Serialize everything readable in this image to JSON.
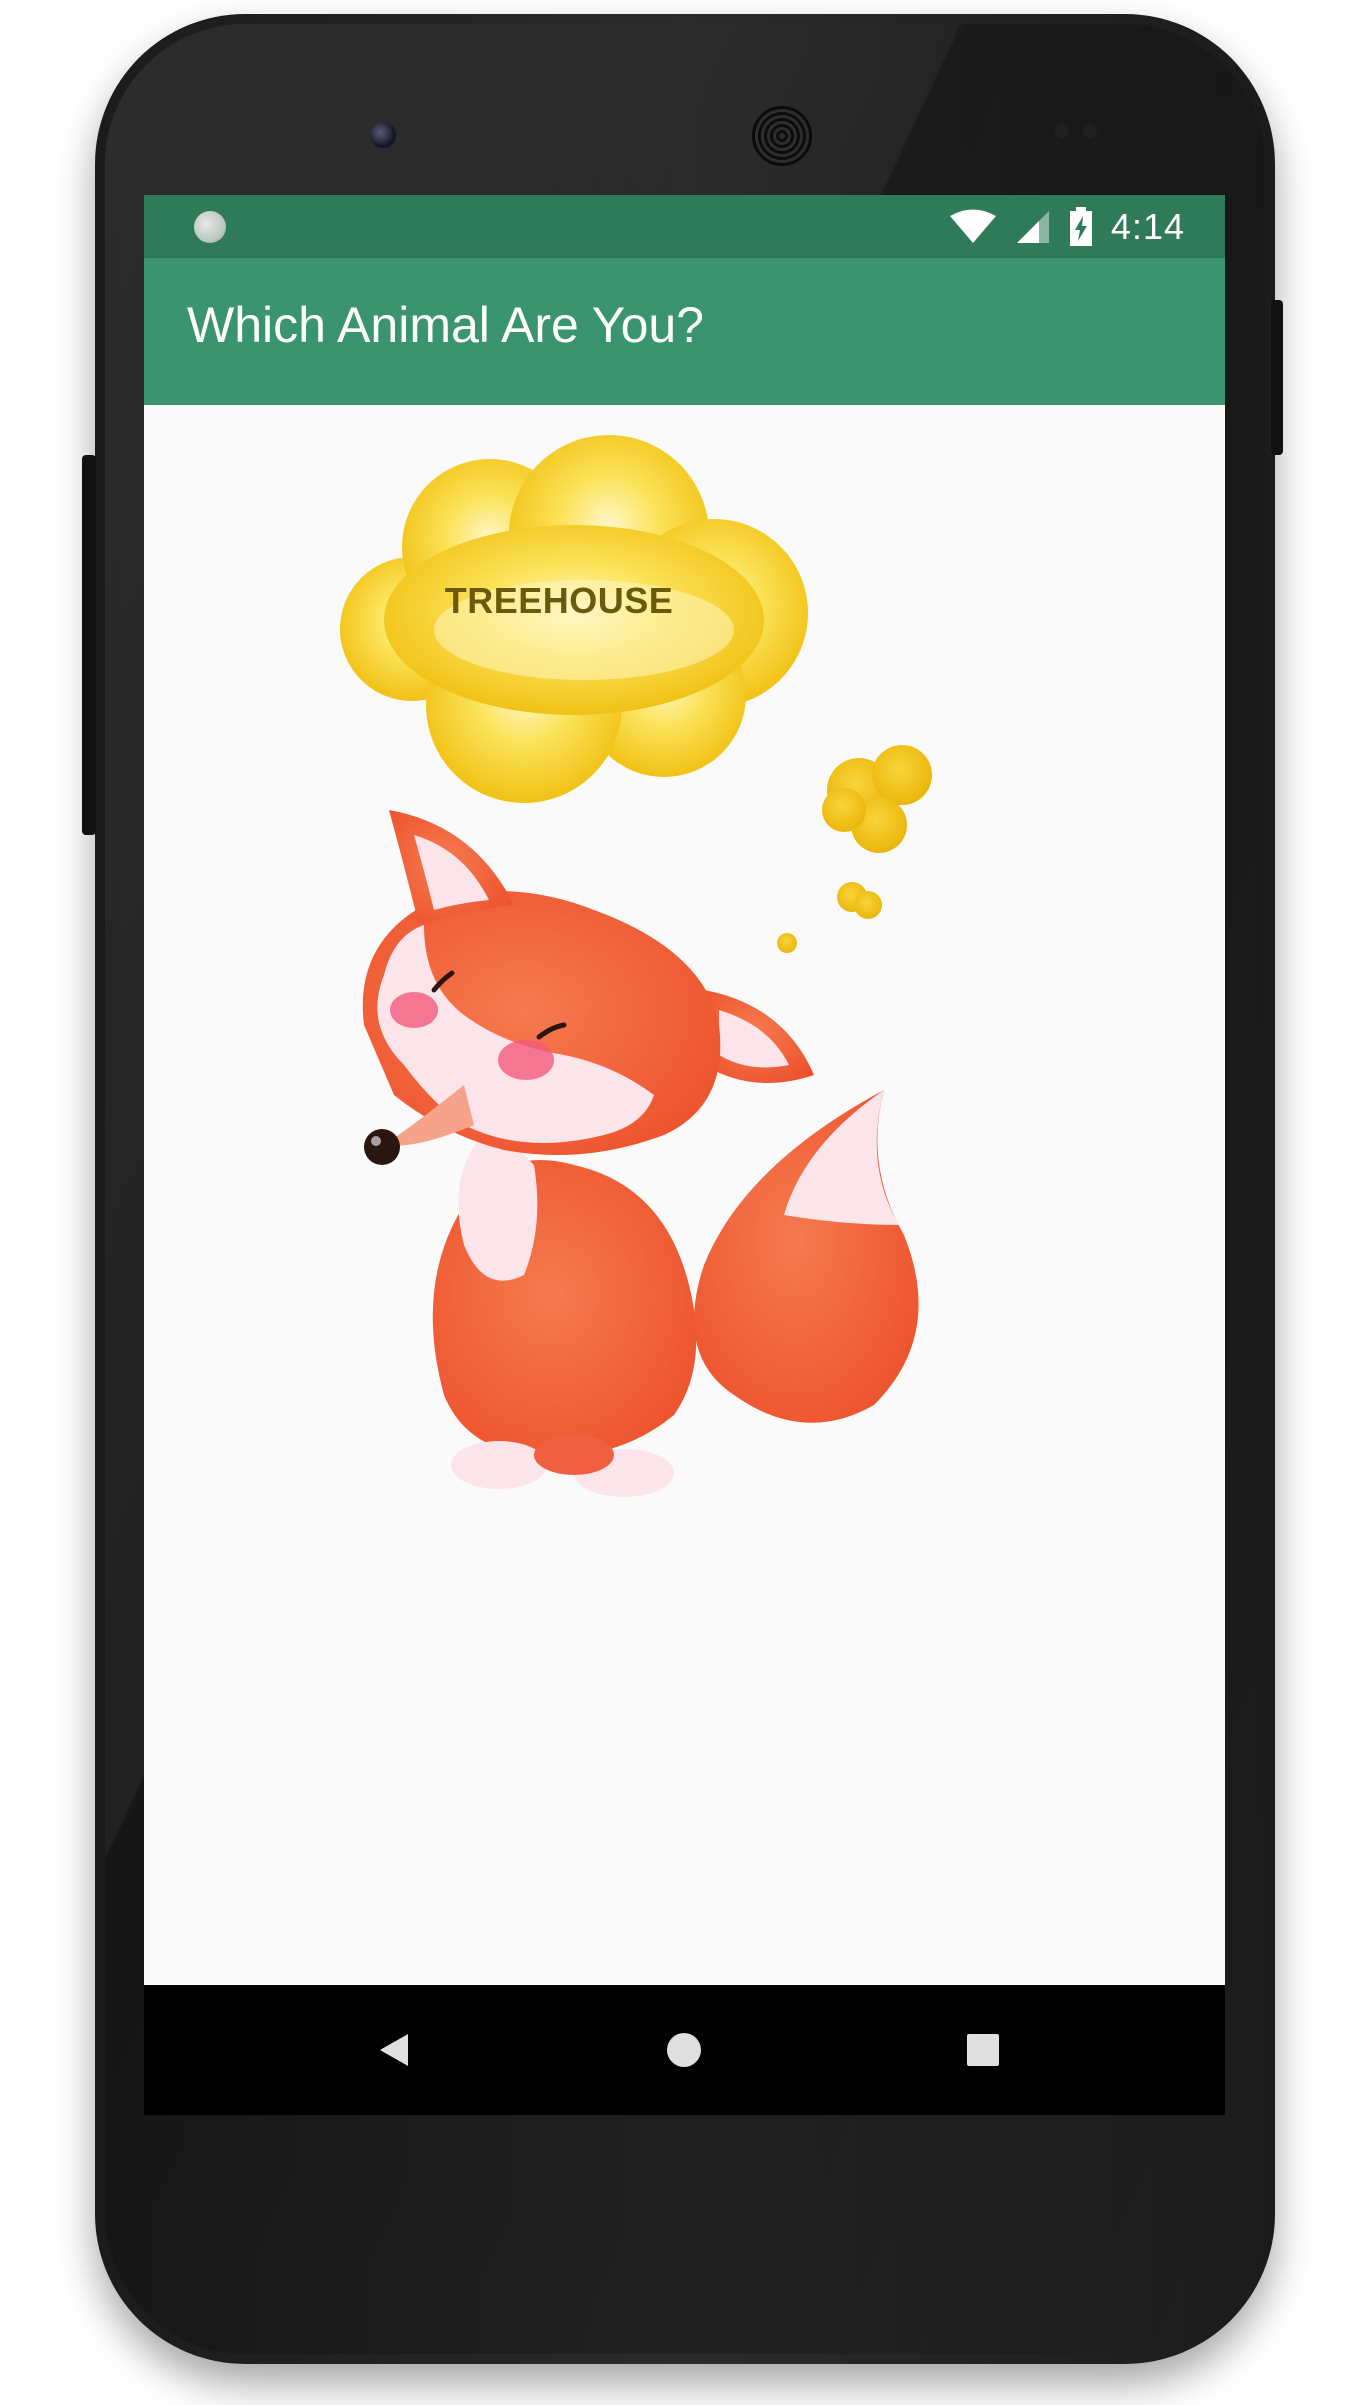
{
  "status_bar": {
    "time": "4:14",
    "icons": [
      "sync-icon",
      "wifi-icon",
      "cellular-signal-icon",
      "battery-charging-icon"
    ]
  },
  "app_bar": {
    "title": "Which Animal Are You?"
  },
  "main": {
    "thought_bubble_text": "TREEHOUSE",
    "illustration": "fox-illustration"
  },
  "nav_bar": {
    "icons": [
      "back-icon",
      "home-icon",
      "recents-icon"
    ]
  },
  "colors": {
    "status_bar": "#2f7a59",
    "app_bar": "#3b9470",
    "background": "#fafafa",
    "bubble": "#f5c814",
    "fox": "#f0643c"
  }
}
